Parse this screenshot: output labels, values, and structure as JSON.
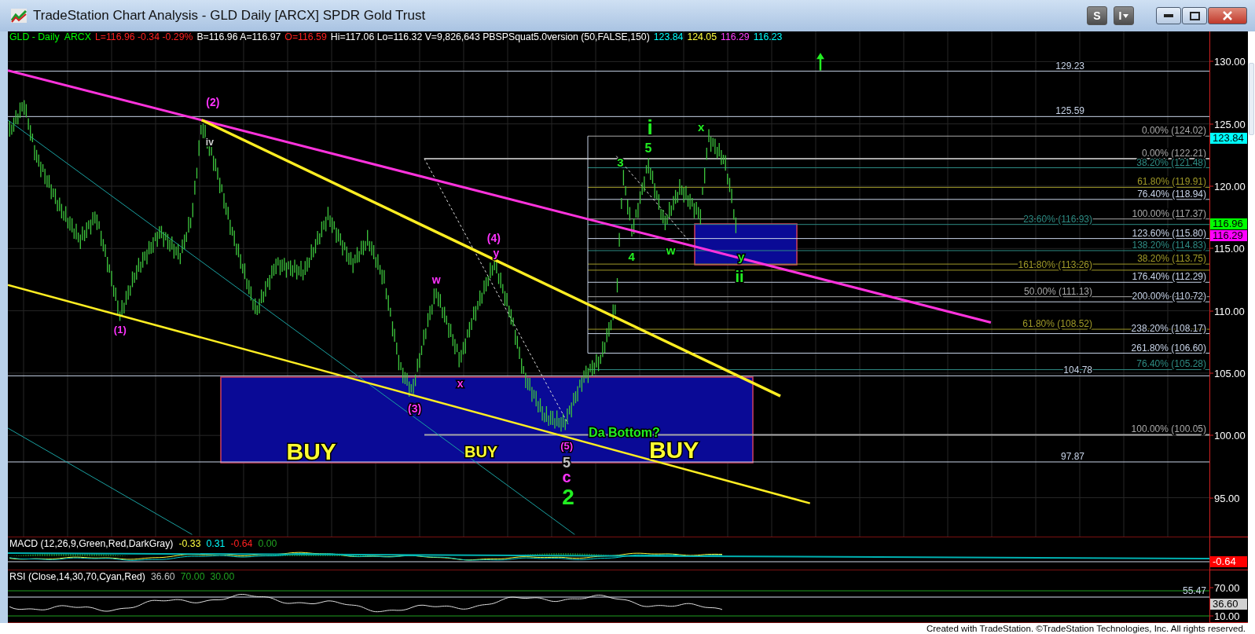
{
  "window": {
    "title": "TradeStation Chart Analysis - GLD Daily [ARCX] SPDR Gold Trust",
    "tool_buttons": [
      "S",
      "I"
    ]
  },
  "header": [
    {
      "text": "GLD - Daily  ARCX",
      "color": "#00ff00"
    },
    {
      "text": "L=116.96 -0.34 -0.29%",
      "color": "#ff2020"
    },
    {
      "text": "B=116.96 A=116.97",
      "color": "#ffffff"
    },
    {
      "text": "O=116.59",
      "color": "#ff2020"
    },
    {
      "text": "Hi=117.06 Lo=116.32 V=9,826,643 PBSPSquat5.0version (50,FALSE,150)",
      "color": "#ffffff"
    },
    {
      "text": "123.84",
      "color": "#00ffff"
    },
    {
      "text": "124.05",
      "color": "#ffff40"
    },
    {
      "text": "116.29",
      "color": "#ff40ff"
    },
    {
      "text": "116.23",
      "color": "#00ffff"
    }
  ],
  "levels": [
    {
      "label": "129.23",
      "color": "#c8d4e8"
    },
    {
      "label": "125.59",
      "color": "#c8d4e8"
    },
    {
      "label": "0.00% (124.02)",
      "color": "#a8a8a8"
    },
    {
      "label": "0.00% (122.21)",
      "color": "#a8a8a8"
    },
    {
      "label": "38.20% (121.48)",
      "color": "#2e8c84"
    },
    {
      "label": "61.80% (119.91)",
      "color": "#a09a28"
    },
    {
      "label": "76.40% (118.94)",
      "color": "#c8d4e8"
    },
    {
      "label": "100.00% (117.37)",
      "color": "#a8a8a8"
    },
    {
      "label": "23.60% (116.93)",
      "color": "#2e8c84"
    },
    {
      "label": "123.60% (115.80)",
      "color": "#c8d4e8"
    },
    {
      "label": "138.20% (114.83)",
      "color": "#2e8c84"
    },
    {
      "label": "38.20% (113.75)",
      "color": "#a09a28"
    },
    {
      "label": "161.80% (113.26)",
      "color": "#a09a28"
    },
    {
      "label": "176.40% (112.29)",
      "color": "#c8d4e8"
    },
    {
      "label": "50.00% (111.13)",
      "color": "#a8a8a8"
    },
    {
      "label": "200.00% (110.72)",
      "color": "#c8d4e8"
    },
    {
      "label": "61.80% (108.52)",
      "color": "#a09a28"
    },
    {
      "label": "238.20% (108.17)",
      "color": "#c8d4e8"
    },
    {
      "label": "261.80% (106.60)",
      "color": "#c8d4e8"
    },
    {
      "label": "76.40% (105.28)",
      "color": "#2e8c84"
    },
    {
      "label": "104.78",
      "color": "#c8d4e8"
    },
    {
      "label": "100.00% (100.05)",
      "color": "#a8a8a8"
    },
    {
      "label": "97.87",
      "color": "#c8d4e8"
    }
  ],
  "annotations": [
    {
      "text": "(2)",
      "color": "#ff33ff"
    },
    {
      "text": "iv",
      "color": "#d0d0d0"
    },
    {
      "text": "(1)",
      "color": "#ff33ff"
    },
    {
      "text": "w",
      "color": "#ff33ff"
    },
    {
      "text": "(4)",
      "color": "#ff33ff"
    },
    {
      "text": "y",
      "color": "#ff33ff"
    },
    {
      "text": "x",
      "color": "#ff33ff"
    },
    {
      "text": "(3)",
      "color": "#ff33ff"
    },
    {
      "text": "(5)",
      "color": "#ff33ff"
    },
    {
      "text": "5",
      "color": "#c0c0c0"
    },
    {
      "text": "c",
      "color": "#ff33ff"
    },
    {
      "text": "2",
      "color": "#22ee22"
    },
    {
      "text": "Da Bottom?",
      "color": "#22ee22"
    },
    {
      "text": "BUY",
      "color": "#ffff33"
    },
    {
      "text": "BUY",
      "color": "#ffff33"
    },
    {
      "text": "BUY",
      "color": "#ffff33"
    },
    {
      "text": "i",
      "color": "#22ee22"
    },
    {
      "text": "5",
      "color": "#22ee22"
    },
    {
      "text": "3",
      "color": "#22ee22"
    },
    {
      "text": "x",
      "color": "#22ee22"
    },
    {
      "text": "4",
      "color": "#22ee22"
    },
    {
      "text": "w",
      "color": "#22ee22"
    },
    {
      "text": "y",
      "color": "#22ee22"
    },
    {
      "text": "ii",
      "color": "#22ee22"
    }
  ],
  "price_axis": {
    "ticks": [
      "130.00",
      "125.00",
      "120.00",
      "115.00",
      "110.00",
      "105.00",
      "100.00",
      "95.00"
    ],
    "markers": [
      {
        "text": "123.84",
        "color": "#00ffff"
      },
      {
        "text": "116.96",
        "color": "#00ff00"
      },
      {
        "text": "116.29",
        "color": "#ff00ff"
      }
    ]
  },
  "macd": {
    "title": "MACD (12,26,9,Green,Red,DarkGray)",
    "values": [
      {
        "text": "-0.33",
        "color": "#ffff40"
      },
      {
        "text": "0.31",
        "color": "#00ffff"
      },
      {
        "text": "-0.64",
        "color": "#ff2020"
      },
      {
        "text": "0.00",
        "color": "#20a020"
      }
    ],
    "marker": {
      "text": "-0.64",
      "color": "#ff0000"
    }
  },
  "rsi": {
    "title": "RSI (Close,14,30,70,Cyan,Red)",
    "values": [
      {
        "text": "36.60",
        "color": "#c0c0c0"
      },
      {
        "text": "70.00",
        "color": "#20a020"
      },
      {
        "text": "30.00",
        "color": "#20a020"
      }
    ],
    "level_label": "55.47",
    "ticks": [
      "70.00",
      "10.00"
    ],
    "marker": {
      "text": "36.60",
      "color": "#d0d0d0"
    }
  },
  "footer": "Created with TradeStation. ©TradeStation Technologies, Inc. All rights reserved."
}
